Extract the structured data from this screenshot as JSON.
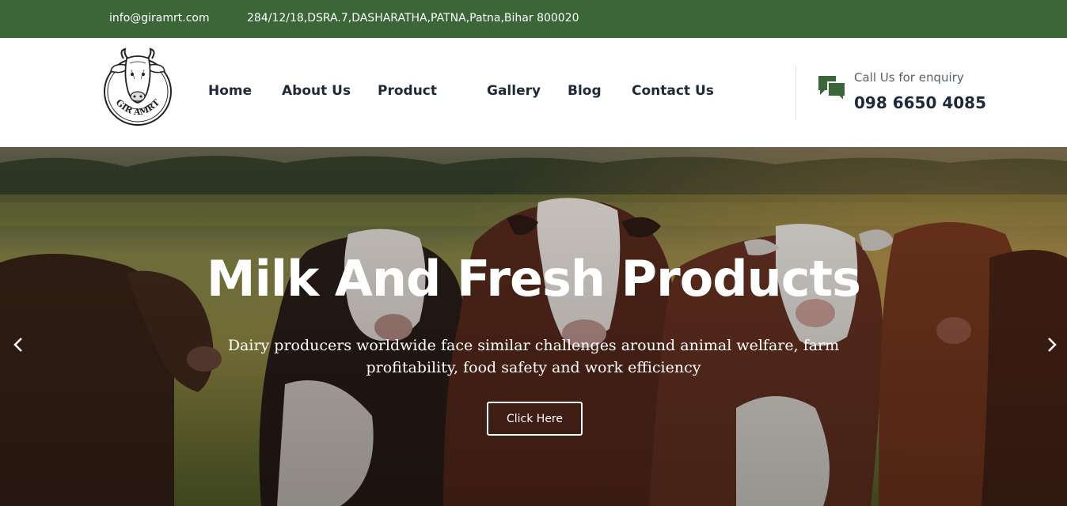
{
  "topbar": {
    "email": "info@giramrt.com",
    "address": "284/12/18,DSRA.7,DASHARATHA,PATNA,Patna,Bihar 800020"
  },
  "header": {
    "logo_text": "GIR AMRT",
    "logo_icon": "cow-head-icon",
    "nav": [
      {
        "label": "Home"
      },
      {
        "label": "About Us"
      },
      {
        "label": "Product"
      },
      {
        "label": "Gallery"
      },
      {
        "label": "Blog"
      },
      {
        "label": "Contact Us"
      }
    ],
    "call_icon": "chat-bubbles-icon",
    "call_label": "Call Us for enquiry",
    "call_number": "098 6650 4085"
  },
  "hero": {
    "title": "Milk And Fresh Products",
    "subtitle": "Dairy producers worldwide face similar challenges around animal welfare, farm profitability, food safety and work efficiency",
    "button_label": "Click Here",
    "prev_icon": "chevron-left-icon",
    "next_icon": "chevron-right-icon"
  },
  "colors": {
    "topbar_bg": "#3a6638",
    "nav_text": "#1d2a3a",
    "accent_green": "#3a6638"
  }
}
